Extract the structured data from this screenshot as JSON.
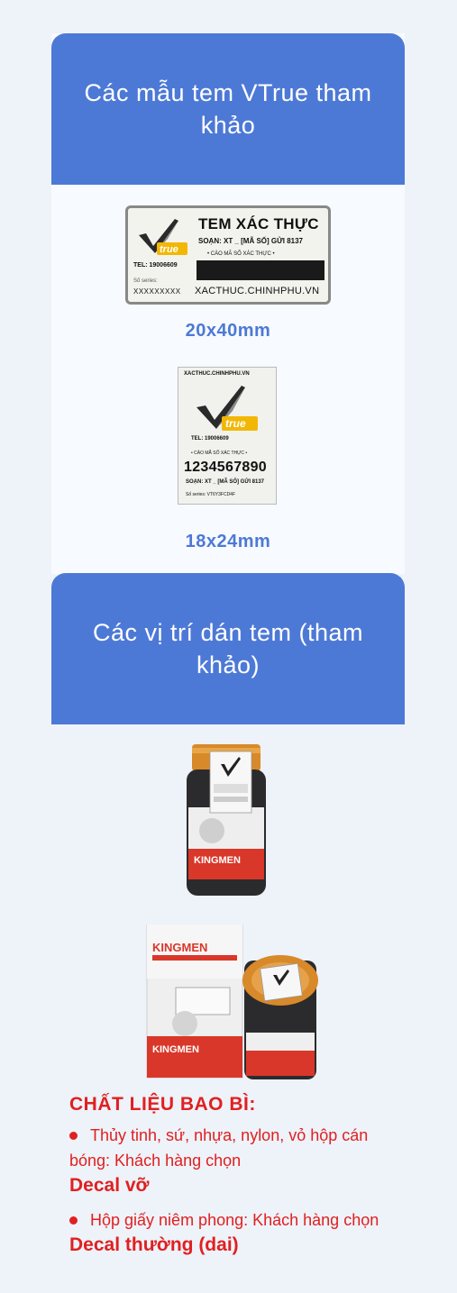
{
  "section1": {
    "title": "Các mẫu tem VTrue tham khảo"
  },
  "label_large": {
    "title": "TEM XÁC THỰC",
    "code": "SOẠN: XT _ [MÃ SỐ] GỬI 8137",
    "scratch_hint": "• CÀO MÃ SỐ XÁC THỰC •",
    "tel": "TEL: 19006609",
    "series_label": "Số series:",
    "series_value": "XXXXXXXXX",
    "url": "XACTHUC.CHINHPHU.VN",
    "size": "20x40mm"
  },
  "label_small": {
    "url": "XACTHUC.CHINHPHU.VN",
    "tel": "TEL: 19006609",
    "hint": "• CÀO MÃ SỐ XÁC THỰC •",
    "number": "1234567890",
    "code": "SOẠN: XT _ [MÃ SỐ] GỬI 8137",
    "series": "Số series: VT6Y3FCD4F",
    "size": "18x24mm"
  },
  "section2": {
    "title": "Các vị trí dán tem (tham khảo)"
  },
  "materials": {
    "heading": "CHẤT LIỆU BAO BÌ:",
    "item1_text": "Thủy tinh, sứ, nhựa, nylon, vỏ hộp cán bóng: Khách hàng chọn",
    "item1_emph": "Decal vỡ",
    "item2_text": "Hộp giấy niêm phong: Khách hàng chọn",
    "item2_emph": "Decal thường (dai)"
  },
  "colors": {
    "banner": "#4d79d6",
    "size_label": "#4d79d6",
    "materials": "#e02020"
  }
}
